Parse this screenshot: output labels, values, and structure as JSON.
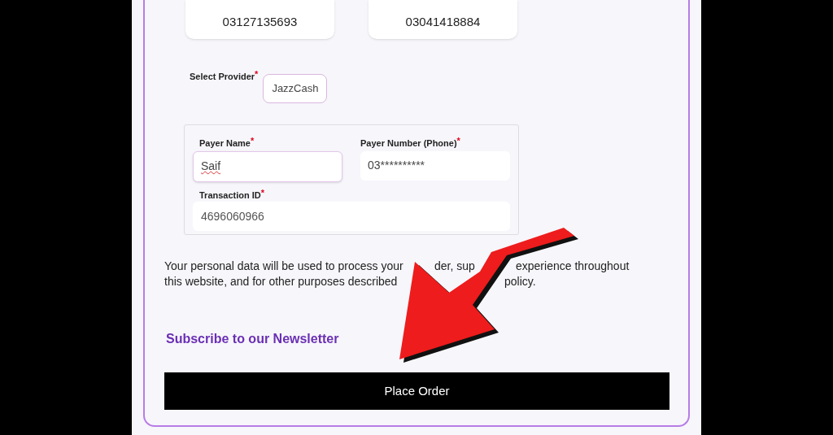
{
  "numbers": [
    "03127135693",
    "03041418884"
  ],
  "provider": {
    "label": "Select Provider",
    "required_mark": "*",
    "value": "JazzCash"
  },
  "payer_name": {
    "label": "Payer Name",
    "required_mark": "*",
    "value": "Saif"
  },
  "payer_number": {
    "label": "Payer Number (Phone)",
    "required_mark": "*",
    "value": "03**********"
  },
  "transaction_id": {
    "label": "Transaction ID",
    "required_mark": "*",
    "value": "4696060966"
  },
  "privacy_lines": [
    [
      "Your personal data will be used to process your",
      "der, sup",
      "experience throughout"
    ],
    [
      "this website, and for other purposes described",
      "policy."
    ]
  ],
  "newsletter": "Subscribe to our Newsletter",
  "place_order": "Place Order"
}
